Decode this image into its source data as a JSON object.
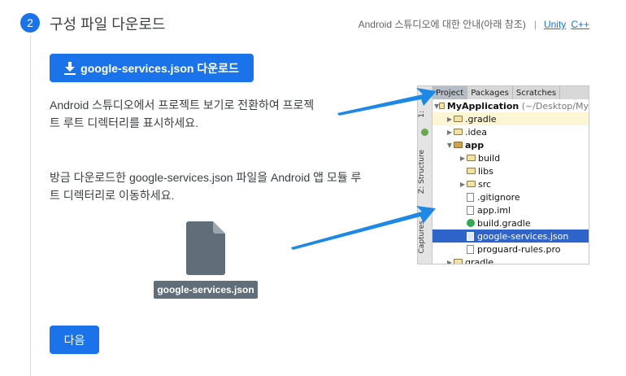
{
  "step": {
    "number": "2",
    "title": "구성 파일 다운로드"
  },
  "guide": {
    "text": "Android 스튜디오에 대한 안내(아래 참조)",
    "separator": "|",
    "links": [
      "Unity",
      "C++"
    ]
  },
  "download_button": {
    "label": "google-services.json 다운로드"
  },
  "instructions": {
    "switch_view": "Android 스튜디오에서 프로젝트 보기로 전환하여 프로젝트 루트 디렉터리를 표시하세요.",
    "move_file": "방금 다운로드한 google-services.json 파일을 Android 앱 모듈 루트 디렉터리로 이동하세요."
  },
  "file": {
    "name": "google-services.json"
  },
  "next_button": {
    "label": "다음"
  },
  "ide": {
    "tabs": [
      "Project",
      "Packages",
      "Scratches"
    ],
    "side_tabs": [
      "1:",
      "Z: Structure",
      "Captures"
    ],
    "tree": {
      "root": {
        "name": "MyApplication",
        "path": "(~/Desktop/My"
      },
      "items": [
        ".gradle",
        ".idea",
        "app",
        "build",
        "libs",
        "src",
        ".gitignore",
        "app.iml",
        "build.gradle",
        "google-services.json",
        "proguard-rules.pro",
        "gradle"
      ]
    }
  },
  "colors": {
    "accent": "#1a73e8",
    "selection": "#2f65ca",
    "arrow": "#1e88e5"
  }
}
